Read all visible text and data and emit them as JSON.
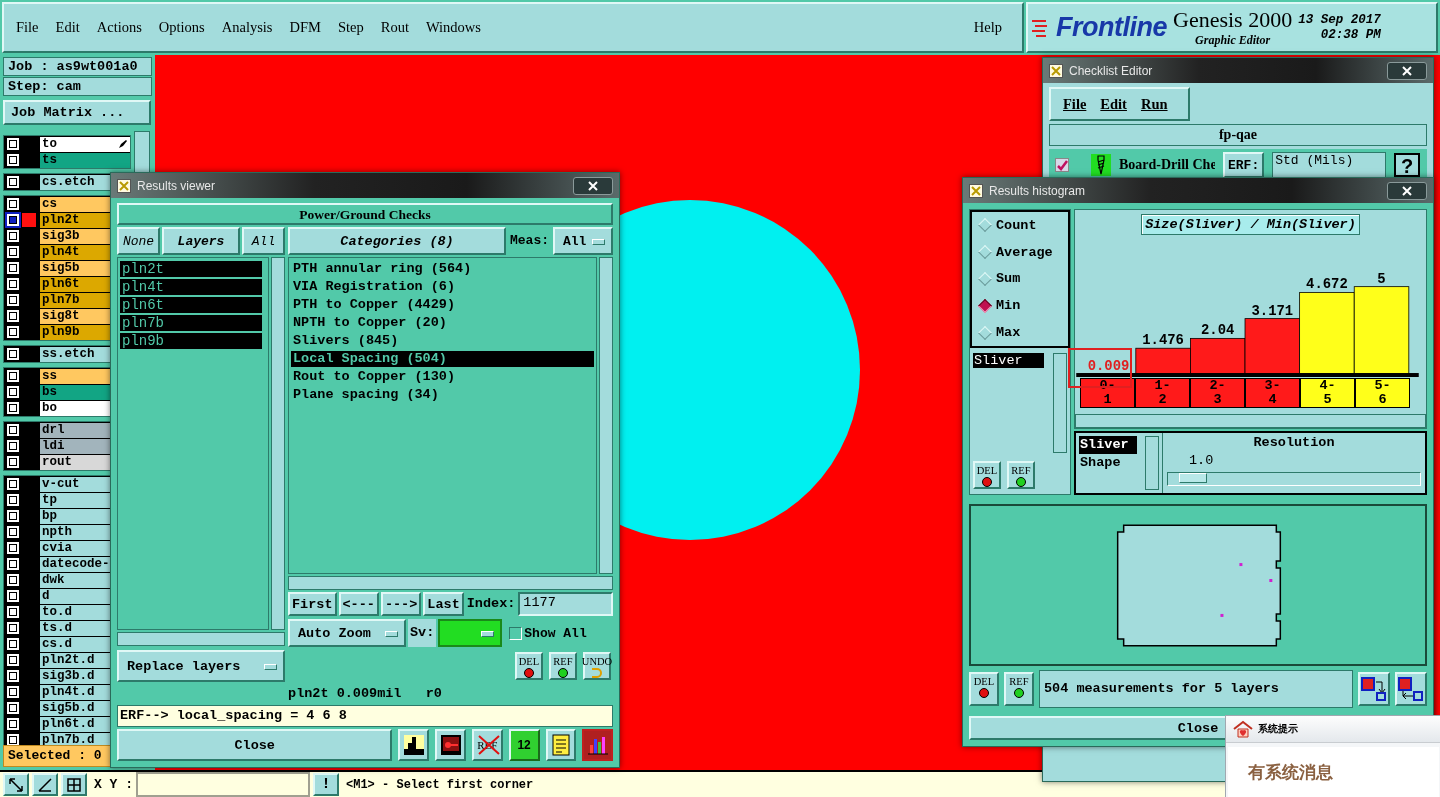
{
  "menu_bar": {
    "items": [
      "File",
      "Edit",
      "Actions",
      "Options",
      "Analysis",
      "DFM",
      "Step",
      "Rout",
      "Windows"
    ],
    "help": "Help"
  },
  "branding": {
    "logo": "Frontline",
    "product": "Genesis 2000",
    "subtitle": "Graphic Editor",
    "date": "13 Sep 2017",
    "time": "02:38 PM"
  },
  "job_panel": {
    "job": "Job : as9wt001a0",
    "step": "Step: cam",
    "matrix_button": "Job Matrix ...",
    "selected_count": "Selected : 0"
  },
  "layer_groups": [
    [
      {
        "name": "to",
        "color": "#ffffff",
        "active": false,
        "editing": true
      },
      {
        "name": "ts",
        "color": "#12a584",
        "active": false,
        "editing": false
      }
    ],
    [
      {
        "name": "cs.etch",
        "color": "#a3dcdc",
        "active": false,
        "editing": false
      }
    ],
    [
      {
        "name": "cs",
        "color": "#ffc860",
        "active": false,
        "editing": false
      },
      {
        "name": "pln2t",
        "color": "#dca800",
        "active": true,
        "editing": false
      },
      {
        "name": "sig3b",
        "color": "#ffc860",
        "active": false,
        "editing": false
      },
      {
        "name": "pln4t",
        "color": "#dca800",
        "active": false,
        "editing": false
      },
      {
        "name": "sig5b",
        "color": "#ffc860",
        "active": false,
        "editing": false
      },
      {
        "name": "pln6t",
        "color": "#dca800",
        "active": false,
        "editing": false
      },
      {
        "name": "pln7b",
        "color": "#dca800",
        "active": false,
        "editing": false
      },
      {
        "name": "sig8t",
        "color": "#ffc860",
        "active": false,
        "editing": false
      },
      {
        "name": "pln9b",
        "color": "#dca800",
        "active": false,
        "editing": false
      }
    ],
    [
      {
        "name": "ss.etch",
        "color": "#a3dcdc",
        "active": false,
        "editing": false
      }
    ],
    [
      {
        "name": "ss",
        "color": "#ffc860",
        "active": false,
        "editing": false
      },
      {
        "name": "bs",
        "color": "#12a584",
        "active": false,
        "editing": false
      },
      {
        "name": "bo",
        "color": "#ffffff",
        "active": false,
        "editing": false
      }
    ],
    [
      {
        "name": "drl",
        "color": "#a2b4bc",
        "active": false,
        "editing": false
      },
      {
        "name": "ldi",
        "color": "#a2b4bc",
        "active": false,
        "editing": false
      },
      {
        "name": "rout",
        "color": "#d8d8d8",
        "active": false,
        "editing": false
      }
    ],
    [
      {
        "name": "v-cut",
        "color": "#a3dcdc",
        "active": false,
        "editing": false
      },
      {
        "name": "tp",
        "color": "#a3dcdc",
        "active": false,
        "editing": false
      },
      {
        "name": "bp",
        "color": "#a3dcdc",
        "active": false,
        "editing": false
      },
      {
        "name": "npth",
        "color": "#a3dcdc",
        "active": false,
        "editing": false
      },
      {
        "name": "cvia",
        "color": "#a3dcdc",
        "active": false,
        "editing": false
      },
      {
        "name": "datecode-",
        "color": "#a3dcdc",
        "active": false,
        "editing": false
      },
      {
        "name": "dwk",
        "color": "#a3dcdc",
        "active": false,
        "editing": false
      },
      {
        "name": "d",
        "color": "#a3dcdc",
        "active": false,
        "editing": false
      },
      {
        "name": "to.d",
        "color": "#a3dcdc",
        "active": false,
        "editing": false
      },
      {
        "name": "ts.d",
        "color": "#a3dcdc",
        "active": false,
        "editing": false
      },
      {
        "name": "cs.d",
        "color": "#a3dcdc",
        "active": false,
        "editing": false
      },
      {
        "name": "pln2t.d",
        "color": "#a3dcdc",
        "active": false,
        "editing": false
      },
      {
        "name": "sig3b.d",
        "color": "#a3dcdc",
        "active": false,
        "editing": false
      },
      {
        "name": "pln4t.d",
        "color": "#a3dcdc",
        "active": false,
        "editing": false
      },
      {
        "name": "sig5b.d",
        "color": "#a3dcdc",
        "active": false,
        "editing": false
      },
      {
        "name": "pln6t.d",
        "color": "#a3dcdc",
        "active": false,
        "editing": false
      },
      {
        "name": "pln7b.d",
        "color": "#a3dcdc",
        "active": false,
        "editing": false
      }
    ]
  ],
  "results_viewer": {
    "title": "Results viewer",
    "heading": "Power/Ground Checks",
    "layer_buttons": [
      "None",
      "Layers",
      "All"
    ],
    "categories_button": "Categories (8)",
    "meas_label": "Meas:",
    "meas_value": "All",
    "layers": [
      {
        "name": "pln2t",
        "selected": true
      },
      {
        "name": "pln4t",
        "selected": true
      },
      {
        "name": "pln6t",
        "selected": true
      },
      {
        "name": "pln7b",
        "selected": true
      },
      {
        "name": "pln9b",
        "selected": true
      }
    ],
    "categories": [
      {
        "label": "PTH annular ring (564)",
        "selected": false
      },
      {
        "label": "VIA Registration (6)",
        "selected": false
      },
      {
        "label": "PTH to Copper (4429)",
        "selected": false
      },
      {
        "label": "NPTH to Copper (20)",
        "selected": false
      },
      {
        "label": "Slivers (845)",
        "selected": false
      },
      {
        "label": "Local Spacing (504)",
        "selected": true
      },
      {
        "label": "Rout to Copper (130)",
        "selected": false
      },
      {
        "label": "Plane spacing (34)",
        "selected": false
      }
    ],
    "nav_buttons": [
      "First",
      "<---",
      "--->",
      "Last"
    ],
    "index_label": "Index:",
    "index_value": "1177",
    "zoom_mode": "Auto Zoom",
    "sv_label": "Sv:",
    "show_all": {
      "label": "Show All",
      "checked": false
    },
    "tool_buttons": [
      {
        "kind": "del",
        "label": "DEL"
      },
      {
        "kind": "ref",
        "label": "REF"
      },
      {
        "kind": "undo",
        "label": "UNDO"
      }
    ],
    "replace_mode": "Replace layers",
    "status": "pln2t 0.009mil   r0",
    "erf_line": "ERF--> local_spacing = 4 6 8",
    "close": "Close",
    "footer_icons": [
      {
        "kind": "figure"
      },
      {
        "kind": "screen"
      },
      {
        "kind": "ref-off",
        "label": "REF"
      },
      {
        "kind": "numbers",
        "label": "12"
      },
      {
        "kind": "notes"
      },
      {
        "kind": "histogram"
      }
    ]
  },
  "checklist_editor": {
    "title": "Checklist Editor",
    "menu": [
      "File",
      "Edit",
      "Run"
    ],
    "checklist": "fp-qae",
    "row": {
      "checked": true,
      "label": "Board-Drill Che",
      "erf_button": "ERF:",
      "erf_value": "Std (Mils)",
      "help_button": "?"
    }
  },
  "results_histogram": {
    "title": "Results histogram",
    "modes": [
      {
        "label": "Count",
        "selected": false
      },
      {
        "label": "Average",
        "selected": false
      },
      {
        "label": "Sum",
        "selected": false
      },
      {
        "label": "Min",
        "selected": true
      },
      {
        "label": "Max",
        "selected": false
      }
    ],
    "types": [
      {
        "label": "Sliver",
        "selected": true
      }
    ],
    "list_buttons": [
      {
        "kind": "del",
        "label": "DEL"
      },
      {
        "kind": "ref",
        "label": "REF"
      }
    ],
    "chart_data": {
      "type": "bar",
      "title": "Size(Sliver) / Min(Sliver)",
      "categories": [
        "0-1",
        "1-2",
        "2-3",
        "3-4",
        "4-5",
        "5-6"
      ],
      "series": [
        {
          "color": "#ff1a1a",
          "values": [
            0.009,
            1.476,
            2.04,
            3.171,
            null,
            null
          ]
        },
        {
          "color": "#ffff1a",
          "values": [
            null,
            null,
            null,
            null,
            4.672,
            5
          ]
        }
      ],
      "stacked": true,
      "data_labels": true,
      "annotations": [
        {
          "x": "0-1"
        }
      ]
    },
    "shapes": [
      {
        "label": "Sliver",
        "selected": true
      },
      {
        "label": "Shape",
        "selected": false
      }
    ],
    "resolution": {
      "label": "Resolution",
      "value": "1.0",
      "level": 0.05
    },
    "footer_buttons": [
      {
        "kind": "del",
        "label": "DEL"
      },
      {
        "kind": "ref",
        "label": "REF"
      }
    ],
    "summary": "504 measurements for 5 layers",
    "close": "Close"
  },
  "notification": {
    "title": "系统提示",
    "message": "有系统消息"
  },
  "command_bar": {
    "xy_label": "X Y :",
    "alert": "!",
    "prompt": "<M1> - Select first corner"
  }
}
